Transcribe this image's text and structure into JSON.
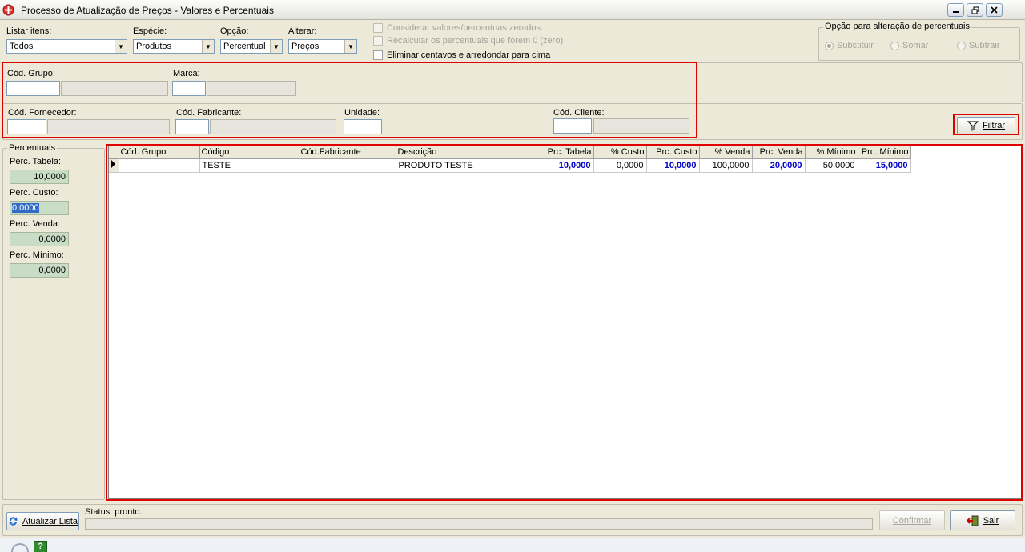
{
  "window": {
    "title": "Processo de Atualização de Preços - Valores e Percentuais"
  },
  "filters": {
    "listar": {
      "label": "Listar itens:",
      "value": "Todos"
    },
    "especie": {
      "label": "Espécie:",
      "value": "Produtos"
    },
    "opcao": {
      "label": "Opção:",
      "value": "Percentual"
    },
    "alterar": {
      "label": "Alterar:",
      "value": "Preços"
    }
  },
  "checks": {
    "considerar": "Considerar valores/percentuas zerados.",
    "recalcular": "Recalcular os percentuais que forem 0 (zero)",
    "eliminar": "Eliminar centavos e arredondar para cima"
  },
  "opcao_alteracao": {
    "title": "Opção para alteração de percentuais",
    "substituir": "Substituir",
    "somar": "Somar",
    "subtrair": "Subtrair"
  },
  "criteria": {
    "grupo": "Cód. Grupo:",
    "marca": "Marca:",
    "fornecedor": "Cód. Fornecedor:",
    "fabricante": "Cód. Fabricante:",
    "unidade": "Unidade:",
    "cliente": "Cód. Cliente:"
  },
  "filtrar_button": {
    "label": "Filtrar"
  },
  "percentuais": {
    "title": "Percentuais",
    "tabela_label": "Perc. Tabela:",
    "tabela_value": "10,0000",
    "custo_label": "Perc. Custo:",
    "custo_value": "0,0000",
    "venda_label": "Perc. Venda:",
    "venda_value": "0,0000",
    "minimo_label": "Perc. Mínimo:",
    "minimo_value": "0,0000"
  },
  "grid": {
    "columns": [
      "Cód. Grupo",
      "Código",
      "Cód.Fabricante",
      "Descrição",
      "Prc. Tabela",
      "% Custo",
      "Prc. Custo",
      "% Venda",
      "Prc. Venda",
      "% Mínimo",
      "Prc. Mínimo"
    ],
    "rows": [
      {
        "grupo": "",
        "codigo": "TESTE",
        "fabricante": "",
        "descricao": "PRODUTO TESTE",
        "prc_tabela": "10,0000",
        "pct_custo": "0,0000",
        "prc_custo": "10,0000",
        "pct_venda": "100,0000",
        "prc_venda": "20,0000",
        "pct_minimo": "50,0000",
        "prc_minimo": "15,0000"
      }
    ]
  },
  "bottom": {
    "atualizar": "Atualizar Lista",
    "status": "Status: pronto.",
    "confirmar": "Confirmar",
    "sair": "Sair"
  },
  "colors": {
    "highlight": "#e00000",
    "value_blue": "#0000c8",
    "perc_field": "#c9dcc5"
  }
}
